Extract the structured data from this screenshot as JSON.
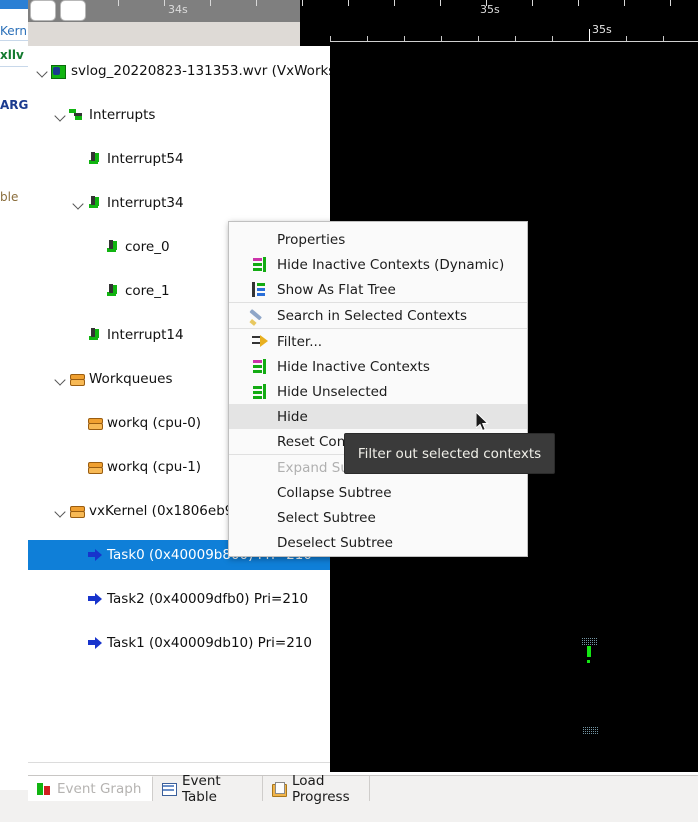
{
  "background_editor": {
    "fragments": [
      "Kern",
      "xllv",
      "ARG",
      "ble"
    ]
  },
  "timeline": {
    "top_ruler": {
      "labels": [
        "34s",
        "35s"
      ]
    },
    "main_ruler": {
      "labels": [
        "35s"
      ]
    }
  },
  "tree": {
    "items": [
      {
        "label": "svlog_20220823-131353.wvr (VxWorks ",
        "icon": "trace-file-icon",
        "expanded": true
      },
      {
        "label": "Interrupts",
        "icon": "interrupts-group-icon",
        "expanded": true
      },
      {
        "label": "Interrupt54",
        "icon": "interrupt-icon"
      },
      {
        "label": "Interrupt34",
        "icon": "interrupt-icon",
        "expanded": true
      },
      {
        "label": "core_0",
        "icon": "interrupt-icon"
      },
      {
        "label": "core_1",
        "icon": "interrupt-icon"
      },
      {
        "label": "Interrupt14",
        "icon": "interrupt-icon"
      },
      {
        "label": "Workqueues",
        "icon": "workqueue-group-icon",
        "expanded": true
      },
      {
        "label": "workq (cpu-0)",
        "icon": "workqueue-icon"
      },
      {
        "label": "workq (cpu-1)",
        "icon": "workqueue-icon"
      },
      {
        "label": "vxKernel (0x1806eb9b",
        "icon": "kernel-icon",
        "expanded": true
      },
      {
        "label": "Task0 (0x40009b800) Pri=210",
        "icon": "task-icon",
        "selected": true
      },
      {
        "label": "Task2 (0x40009dfb0) Pri=210",
        "icon": "task-icon"
      },
      {
        "label": "Task1 (0x40009db10) Pri=210",
        "icon": "task-icon"
      }
    ]
  },
  "context_menu": {
    "items": [
      {
        "label": "Properties",
        "icon": null,
        "enabled": true
      },
      {
        "label": "Hide Inactive Contexts (Dynamic)",
        "icon": "hide-inactive-dynamic-icon",
        "enabled": true
      },
      {
        "label": "Show As Flat Tree",
        "icon": "flat-tree-icon",
        "enabled": true
      },
      {
        "label": "Search in Selected Contexts",
        "icon": "search-pencil-icon",
        "enabled": true
      },
      {
        "label": "Filter...",
        "icon": "filter-icon",
        "enabled": true
      },
      {
        "label": "Hide Inactive Contexts",
        "icon": "hide-inactive-icon",
        "enabled": true
      },
      {
        "label": "Hide Unselected",
        "icon": "hide-unselected-icon",
        "enabled": true
      },
      {
        "label": "Hide",
        "icon": null,
        "enabled": true,
        "highlighted": true
      },
      {
        "label": "Reset Context Filter",
        "icon": null,
        "enabled": true
      },
      {
        "label": "Expand Subtree",
        "icon": null,
        "enabled": false
      },
      {
        "label": "Collapse Subtree",
        "icon": null,
        "enabled": true
      },
      {
        "label": "Select Subtree",
        "icon": null,
        "enabled": true
      },
      {
        "label": "Deselect Subtree",
        "icon": null,
        "enabled": true
      }
    ]
  },
  "tooltip": {
    "text": "Filter out selected contexts"
  },
  "tabs": [
    {
      "label": "Event Graph",
      "icon": "event-graph-icon",
      "active": true
    },
    {
      "label": "Event Table",
      "icon": "event-table-icon",
      "active": false
    },
    {
      "label": "Load Progress",
      "icon": "load-progress-icon",
      "active": false
    }
  ],
  "colors": {
    "selection_blue": "#0f7fd8",
    "menu_background": "#fafafa",
    "menu_highlight": "#e4e4e4",
    "tooltip_background": "#3a3a3a",
    "graph_background": "#000000",
    "ruler_gray": "#7f7f7f",
    "event_green": "#14e614"
  }
}
